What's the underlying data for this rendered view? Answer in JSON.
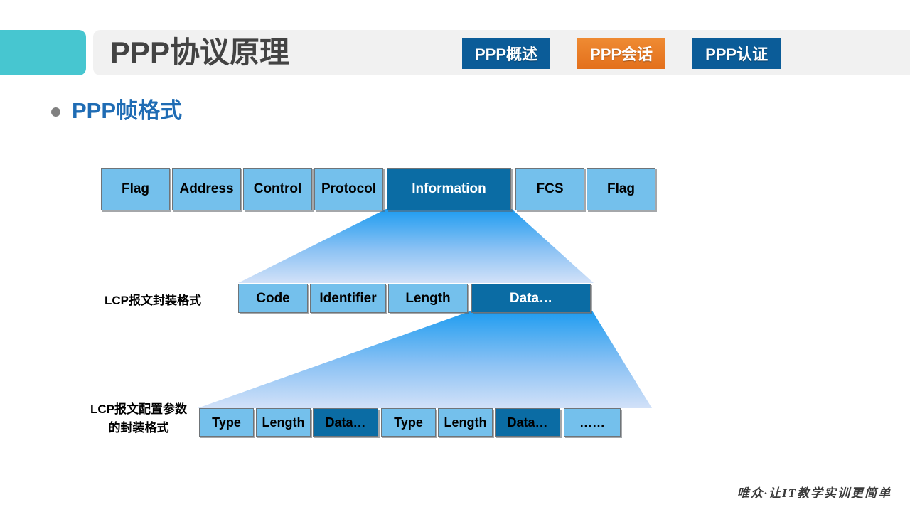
{
  "header": {
    "title": "PPP协议原理",
    "nav_buttons": [
      {
        "label": "PPP概述",
        "style": "blue"
      },
      {
        "label": "PPP会话",
        "style": "orange"
      },
      {
        "label": "PPP认证",
        "style": "blue"
      }
    ],
    "accent_teal": "#47c6d0",
    "panel_bg": "#f1f1f1",
    "title_color": "#434343",
    "nav_blue": "#0b5c98",
    "nav_orange": "#e8781f"
  },
  "section": {
    "heading": "PPP帧格式",
    "heading_color": "#1f6cb4",
    "bullet_color": "#808080"
  },
  "diagram": {
    "cell_fill": "#74c0ec",
    "cell_dark_fill": "#0b6ca4",
    "cell_border": "#6f7478",
    "funnel_top_color": "#1e9cf0",
    "funnel_bottom_color": "#cfe0f7",
    "ppp_frame": {
      "cells": [
        {
          "label": "Flag",
          "dark": false
        },
        {
          "label": "Address",
          "dark": false
        },
        {
          "label": "Control",
          "dark": false
        },
        {
          "label": "Protocol",
          "dark": false
        },
        {
          "label": "Information",
          "dark": true
        },
        {
          "label": "FCS",
          "dark": false
        },
        {
          "label": "Flag",
          "dark": false
        }
      ]
    },
    "lcp_packet": {
      "label": "LCP报文封装格式",
      "cells": [
        {
          "label": "Code",
          "dark": false
        },
        {
          "label": "Identifier",
          "dark": false
        },
        {
          "label": "Length",
          "dark": false
        },
        {
          "label": "Data…",
          "dark": true
        }
      ]
    },
    "lcp_options": {
      "label_line1": "LCP报文配置参数",
      "label_line2": "的封装格式",
      "cells": [
        {
          "label": "Type",
          "dark": false
        },
        {
          "label": "Length",
          "dark": false
        },
        {
          "label": "Data…",
          "dark": true
        },
        {
          "label": "Type",
          "dark": false
        },
        {
          "label": "Length",
          "dark": false
        },
        {
          "label": "Data…",
          "dark": true
        },
        {
          "label": "……",
          "dark": false
        }
      ]
    }
  },
  "footer": {
    "text": "唯众·让IT教学实训更简单"
  }
}
